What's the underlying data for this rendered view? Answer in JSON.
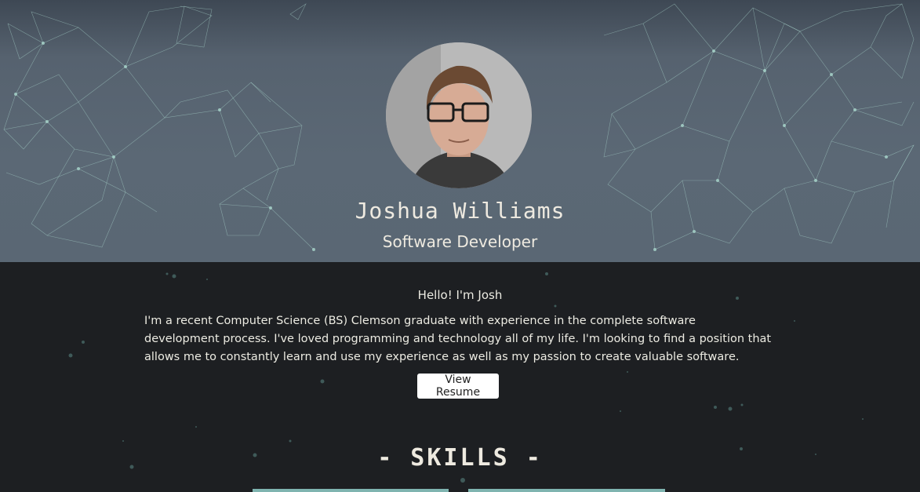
{
  "profile": {
    "name": "Joshua Williams",
    "role": "Software Developer",
    "photo_icon": "profile-photo"
  },
  "about": {
    "greeting": "Hello! I'm Josh",
    "bio": "I'm a recent Computer Science (BS) Clemson graduate with experience in the complete software development process. I've loved programming and technology all of my life. I'm looking to find a position that allows me to constantly learn and use my experience as well as my passion to create valuable software.",
    "resume_button": "View Resume"
  },
  "skills": {
    "heading": "- SKILLS -"
  },
  "colors": {
    "hero_bg": "#5b6875",
    "page_bg": "#1d1f22",
    "network_line": "#9fd3c7",
    "card_accent": "#7fb4b0"
  }
}
